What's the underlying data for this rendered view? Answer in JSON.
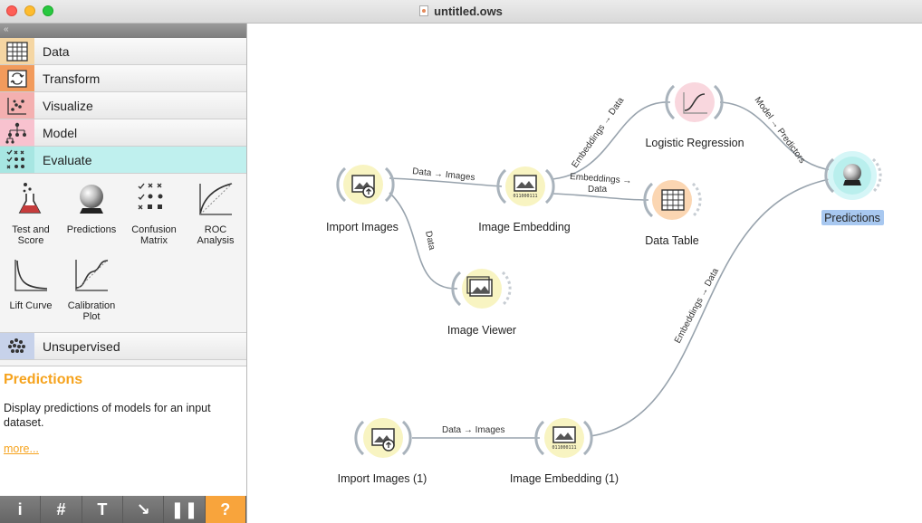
{
  "window": {
    "title": "untitled.ows"
  },
  "sidebar": {
    "collapse_glyph": "«",
    "categories": [
      {
        "label": "Data",
        "color": "#f5d6a3",
        "icon": "table-icon"
      },
      {
        "label": "Transform",
        "color": "#f29b5c",
        "icon": "transform-icon"
      },
      {
        "label": "Visualize",
        "color": "#f4b0b0",
        "icon": "scatter-icon"
      },
      {
        "label": "Model",
        "color": "#f8c2cf",
        "icon": "tree-icon"
      },
      {
        "label": "Evaluate",
        "color": "#a7e6e2",
        "icon": "evaluate-icon"
      },
      {
        "label": "Unsupervised",
        "color": "#c7d2ea",
        "icon": "clusters-icon"
      }
    ],
    "widgets": [
      {
        "label1": "Test and",
        "label2": "Score"
      },
      {
        "label1": "Predictions",
        "label2": ""
      },
      {
        "label1": "Confusion",
        "label2": "Matrix"
      },
      {
        "label1": "ROC",
        "label2": "Analysis"
      },
      {
        "label1": "Lift Curve",
        "label2": ""
      },
      {
        "label1": "Calibration",
        "label2": "Plot"
      }
    ]
  },
  "description": {
    "title": "Predictions",
    "text": "Display predictions of models for an input dataset.",
    "more": "more..."
  },
  "toolbar": {
    "info": "i",
    "grid": "#",
    "text": "T",
    "arrow": "↘",
    "pause": "❚❚",
    "help": "?"
  },
  "canvas": {
    "nodes": {
      "import_images": "Import Images",
      "image_embedding": "Image Embedding",
      "image_viewer": "Image Viewer",
      "logistic_regression": "Logistic Regression",
      "data_table": "Data Table",
      "predictions": "Predictions",
      "import_images_1": "Import Images (1)",
      "image_embedding_1": "Image Embedding (1)"
    },
    "edges": {
      "data_images_1": "Data → Images",
      "data": "Data",
      "embeddings_data_lr": "Embeddings → Data",
      "embeddings_data_dt_1": "Embeddings →",
      "embeddings_data_dt_2": "Data",
      "model_predictors": "Model → Predictors",
      "data_images_2": "Data → Images",
      "embeddings_data_pred": "Embeddings → Data"
    },
    "embedding_bits": "011000111"
  }
}
